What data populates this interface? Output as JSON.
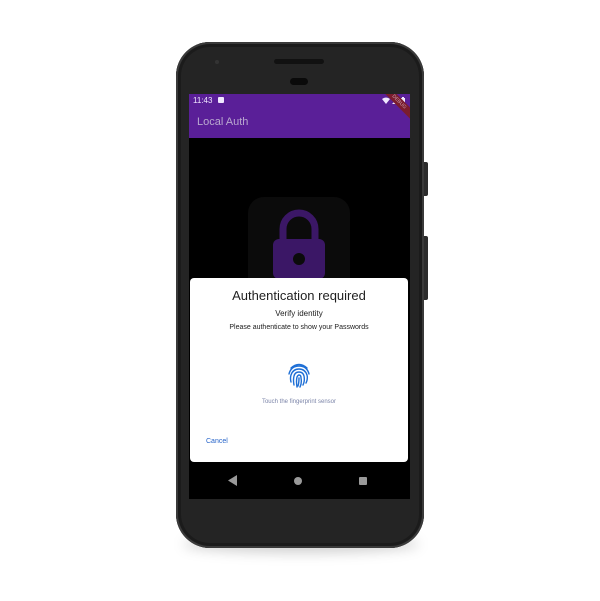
{
  "status_bar": {
    "time": "11:43"
  },
  "app_bar": {
    "title": "Local Auth",
    "debug_banner": "DEBUG"
  },
  "background": {
    "icon": "lock-icon"
  },
  "dialog": {
    "title": "Authentication required",
    "subtitle": "Verify identity",
    "description": "Please authenticate to show your Passwords",
    "icon": "fingerprint-icon",
    "hint": "Touch the fingerprint sensor",
    "cancel_label": "Cancel"
  },
  "nav_bar": {
    "back_icon": "back-triangle-icon",
    "home_icon": "home-circle-icon",
    "recents_icon": "recents-square-icon"
  },
  "colors": {
    "app_bar": "#5a1f98",
    "lock": "#3b1766",
    "cancel_text": "#2563c9",
    "fingerprint": "#1e6fd6"
  }
}
